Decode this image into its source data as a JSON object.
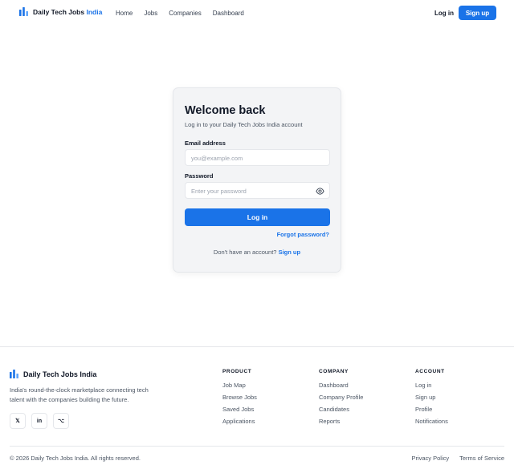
{
  "header": {
    "brand_name": "Daily Tech Jobs",
    "brand_accent": "India",
    "nav": [
      "Home",
      "Jobs",
      "Companies",
      "Dashboard"
    ],
    "login_label": "Log in",
    "signup_label": "Sign up"
  },
  "login": {
    "title": "Welcome back",
    "subtitle": "Log in to your Daily Tech Jobs India account",
    "email_label": "Email address",
    "email_placeholder": "you@example.com",
    "password_label": "Password",
    "password_placeholder": "Enter your password",
    "submit_label": "Log in",
    "forgot_label": "Forgot password?",
    "no_account_text": "Don't have an account?",
    "signup_link": "Sign up"
  },
  "footer": {
    "brand": "Daily Tech Jobs India",
    "description": "India's round-the-clock marketplace connecting tech talent with the companies building the future.",
    "socials": [
      {
        "icon": "x-icon",
        "glyph": "𝕏"
      },
      {
        "icon": "linkedin-icon",
        "glyph": "in"
      },
      {
        "icon": "github-icon",
        "glyph": "⌥"
      }
    ],
    "columns": [
      {
        "title": "PRODUCT",
        "links": [
          "Job Map",
          "Browse Jobs",
          "Saved Jobs",
          "Applications"
        ]
      },
      {
        "title": "COMPANY",
        "links": [
          "Dashboard",
          "Company Profile",
          "Candidates",
          "Reports"
        ]
      },
      {
        "title": "ACCOUNT",
        "links": [
          "Log in",
          "Sign up",
          "Profile",
          "Notifications"
        ]
      }
    ],
    "copyright": "© 2026 Daily Tech Jobs India. All rights reserved.",
    "legal": [
      "Privacy Policy",
      "Terms of Service"
    ]
  },
  "colors": {
    "accent": "#1a73e8",
    "card_bg": "#f3f4f6",
    "text": "#111827",
    "muted": "#4b5563"
  },
  "icons": [
    "bar-chart-logo-icon",
    "eye-icon"
  ]
}
